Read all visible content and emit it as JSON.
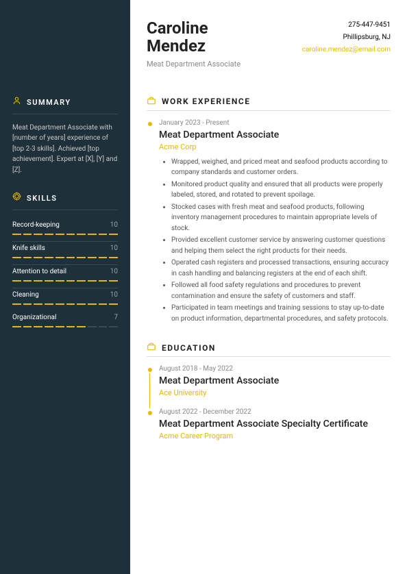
{
  "colors": {
    "accent": "#e6b800",
    "sidebar_bg": "#1e3039"
  },
  "person": {
    "first_name": "Caroline",
    "last_name": "Mendez",
    "title": "Meat Department Associate"
  },
  "contact": {
    "phone": "275-447-9451",
    "location": "Phillipsburg, NJ",
    "email": "caroline.mendez@email.com"
  },
  "summary": {
    "heading": "SUMMARY",
    "icon": "person-icon",
    "text": "Meat Department Associate with [number of years] experience of [top 2-3 skills]. Achieved [top achievement]. Expert at [X], [Y] and [Z]."
  },
  "skills": {
    "heading": "SKILLS",
    "icon": "target-icon",
    "items": [
      {
        "name": "Record-keeping",
        "score": 10
      },
      {
        "name": "Knife skills",
        "score": 10
      },
      {
        "name": "Attention to detail",
        "score": 10
      },
      {
        "name": "Cleaning",
        "score": 10
      },
      {
        "name": "Organizational",
        "score": 7
      }
    ]
  },
  "work": {
    "heading": "WORK EXPERIENCE",
    "icon": "briefcase-icon",
    "entries": [
      {
        "date": "January 2023 - Present",
        "title": "Meat Department Associate",
        "org": "Acme Corp",
        "bullets": [
          "Wrapped, weighed, and priced meat and seafood products according to company standards and customer orders.",
          "Monitored product quality and ensured that all products were properly labeled, stored, and rotated to prevent spoilage.",
          "Stocked cases with fresh meat and seafood products, following inventory management procedures to maintain appropriate levels of stock.",
          "Provided excellent customer service by answering customer questions and helping them select the right products for their needs.",
          "Operated cash registers and processed transactions, ensuring accuracy in cash handling and balancing registers at the end of each shift.",
          "Followed all food safety regulations and procedures to prevent contamination and ensure the safety of customers and staff.",
          "Participated in team meetings and training sessions to stay up-to-date on product information, departmental procedures, and safety protocols."
        ]
      }
    ]
  },
  "education": {
    "heading": "EDUCATION",
    "icon": "briefcase-icon",
    "entries": [
      {
        "date": "August 2018 - May 2022",
        "title": "Meat Department Associate",
        "org": "Ace University"
      },
      {
        "date": "August 2022 - December 2022",
        "title": "Meat Department Associate Specialty Certificate",
        "org": "Acme Career Program"
      }
    ]
  }
}
